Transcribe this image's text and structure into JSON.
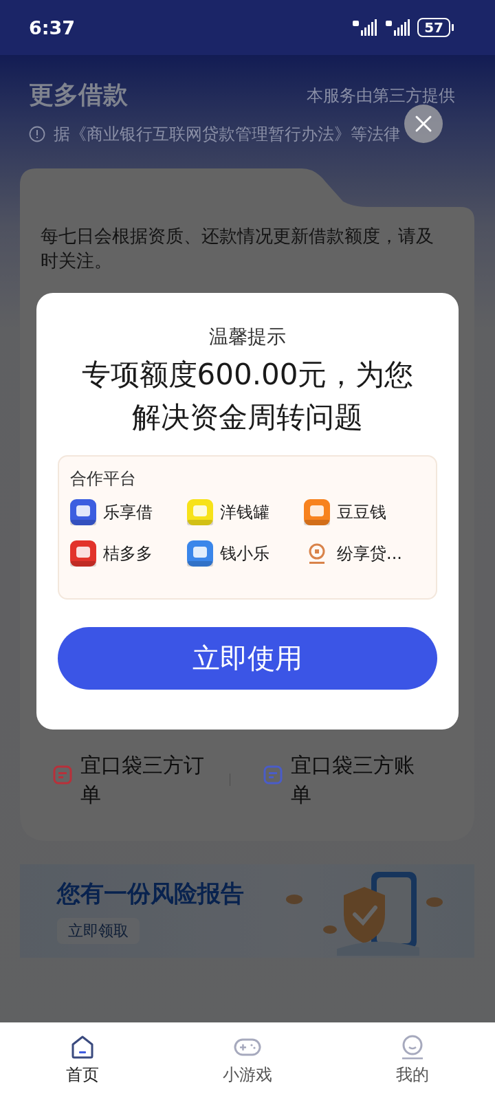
{
  "status_bar": {
    "time": "6:37",
    "battery": "57"
  },
  "header": {
    "title": "更多借款",
    "note": "本服务由第三方提供"
  },
  "notice": {
    "text": "据《商业银行互联网贷款管理暂行办法》等法律"
  },
  "card": {
    "text": "每七日会根据资质、还款情况更新借款额度，请及时关注。",
    "links": [
      {
        "label": "宜口袋三方订单",
        "color": "#b8303a"
      },
      {
        "label": "宜口袋三方账单",
        "color": "#4a5cc8"
      }
    ]
  },
  "banner": {
    "title": "您有一份风险报告",
    "button": "立即领取"
  },
  "dialog": {
    "title": "温馨提示",
    "headline": "专项额度600.00元，为您解决资金周转问题",
    "platforms_title": "合作平台",
    "platforms": [
      {
        "name": "乐享借",
        "kind": "tile",
        "color": "#3c5ee0"
      },
      {
        "name": "洋钱罐",
        "kind": "tile",
        "color": "#f7e21a"
      },
      {
        "name": "豆豆钱",
        "kind": "tile",
        "color": "#f7821e"
      },
      {
        "name": "桔多多",
        "kind": "tile",
        "color": "#e2332b"
      },
      {
        "name": "钱小乐",
        "kind": "tile",
        "color": "#3a86ea"
      },
      {
        "name": "纷享贷...",
        "kind": "ring",
        "color": "#d9834a"
      }
    ],
    "button": "立即使用"
  },
  "tabs": [
    {
      "label": "首页",
      "kind": "home",
      "selected": true
    },
    {
      "label": "小游戏",
      "kind": "game",
      "selected": false
    },
    {
      "label": "我的",
      "kind": "face",
      "selected": false
    }
  ]
}
